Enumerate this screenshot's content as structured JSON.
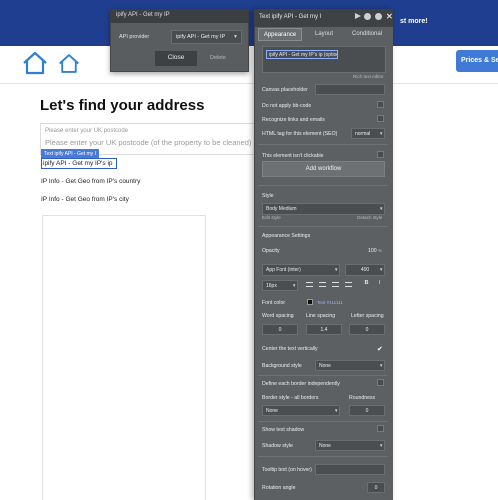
{
  "banner": {
    "text": "st more!"
  },
  "header": {
    "action_button": "Prices & Se"
  },
  "page": {
    "heading": "Let's find your address",
    "postcode_label": "Please enter your UK postcode",
    "postcode_placeholder": "Please enter your UK postcode (of the property to be cleaned)",
    "selected_tag": "Text ipify API - Get my I",
    "selected_text": "ipify API - Get my IP's ip",
    "ip_info_country": "IP Info - Get Geo from IP's country",
    "ip_info_city": "IP Info - Get Geo from IP's city"
  },
  "popup": {
    "title": "ipify API - Get my IP",
    "provider_label": "API provider",
    "provider_value": "ipify API - Get my IP",
    "close": "Close",
    "delete": "Delete"
  },
  "editor": {
    "title": "Text ipify API - Get my I",
    "tabs": [
      "Appearance",
      "Layout",
      "Conditional"
    ],
    "dynamic_text": "ipify API - Get my IP's ip (option)",
    "rich_text_editor": "Rich text editor",
    "canvas_placeholder": "Canvas placeholder",
    "no_bb_code": "Do not apply bb-code",
    "recognize_links": "Recognize links and emails",
    "html_tag_label": "HTML tag for this element (SEO)",
    "html_tag_value": "normal",
    "not_clickable": "This element isn't clickable",
    "add_workflow": "Add workflow",
    "style_label": "Style",
    "style_value": "Body Medium",
    "edit_style": "Edit style",
    "detach_style": "Detach style",
    "appearance_settings": "Appearance Settings",
    "opacity_label": "Opacity",
    "opacity_value": "100",
    "opacity_unit": "%",
    "font_value": "App Font (inter)",
    "font_weight": "400",
    "font_size": "16px",
    "bold": "B",
    "italic": "I",
    "font_color_label": "Font color",
    "font_color_value": "Text #111111",
    "word_spacing_label": "Word spacing",
    "word_spacing_value": "0",
    "line_spacing_label": "Line spacing",
    "line_spacing_value": "1.4",
    "letter_spacing_label": "Letter spacing",
    "letter_spacing_value": "0",
    "center_vertically": "Center the text vertically",
    "background_style_label": "Background style",
    "background_style_value": "None",
    "border_independent": "Define each border independently",
    "border_style_label": "Border style - all borders",
    "border_style_value": "None",
    "roundness_label": "Roundness",
    "roundness_value": "0",
    "show_text_shadow": "Show text shadow",
    "shadow_style_label": "Shadow style",
    "shadow_style_value": "None",
    "tooltip_label": "Tooltip text (on hover)",
    "rotation_label": "Rotation angle",
    "rotation_value": "0"
  },
  "icons": [
    "house-icon",
    "house-icon",
    "play-icon",
    "info-icon",
    "help-icon",
    "close-icon",
    "align-left-icon",
    "align-center-icon",
    "align-right-icon",
    "align-justify-icon",
    "checkmark-icon"
  ],
  "colors": {
    "banner": "#1f3e8f",
    "panel": "#5d6063",
    "selection": "#2d5fc4",
    "button": "#3f7bd6"
  }
}
